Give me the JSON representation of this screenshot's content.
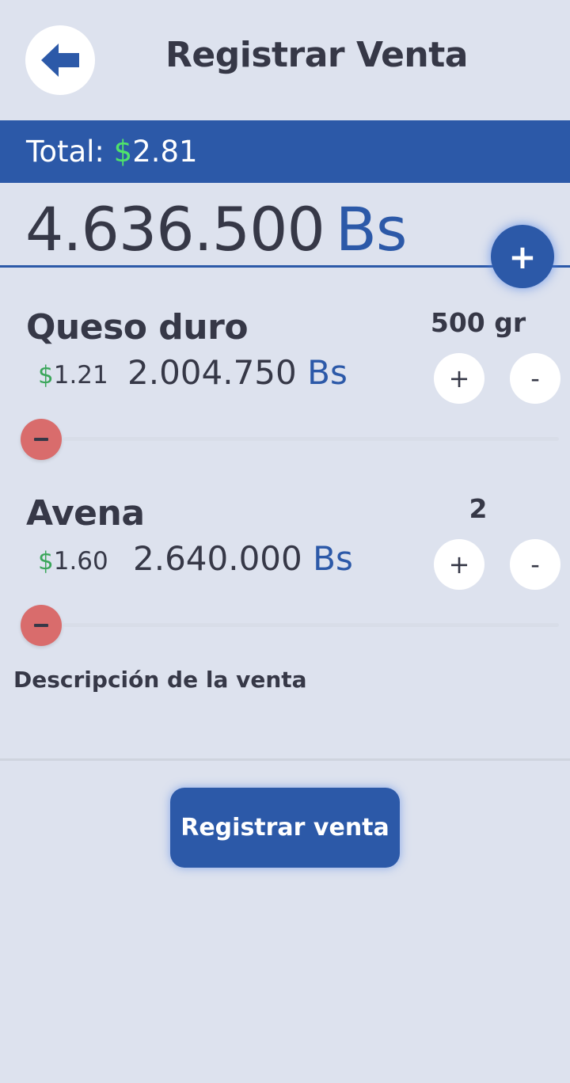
{
  "header": {
    "title": "Registrar Venta",
    "back_icon": "arrow-left-icon"
  },
  "total": {
    "label": "Total:",
    "currency_symbol": "$",
    "amount": "2.81"
  },
  "amount_input": {
    "value": "4.636.500",
    "currency": "Bs"
  },
  "add_button": {
    "label": "+",
    "icon": "plus-icon"
  },
  "items": [
    {
      "name": "Queso duro",
      "quantity": "500 gr",
      "usd_symbol": "$",
      "usd_price": "1.21",
      "bs_amount": "2.004.750",
      "bs_currency": "Bs",
      "plus_label": "+",
      "minus_label": "-"
    },
    {
      "name": "Avena",
      "quantity": "2",
      "usd_symbol": "$",
      "usd_price": "1.60",
      "bs_amount": "2.640.000",
      "bs_currency": "Bs",
      "plus_label": "+",
      "minus_label": "-"
    }
  ],
  "description": {
    "label": "Descripción de la venta",
    "value": ""
  },
  "submit": {
    "label": "Registrar venta"
  },
  "colors": {
    "primary": "#2c59a8",
    "background": "#dde2ee",
    "dollar_highlight": "#4fe36a",
    "dollar_green": "#3aa65a",
    "remove_red": "#d96c6c",
    "text": "#363847"
  }
}
